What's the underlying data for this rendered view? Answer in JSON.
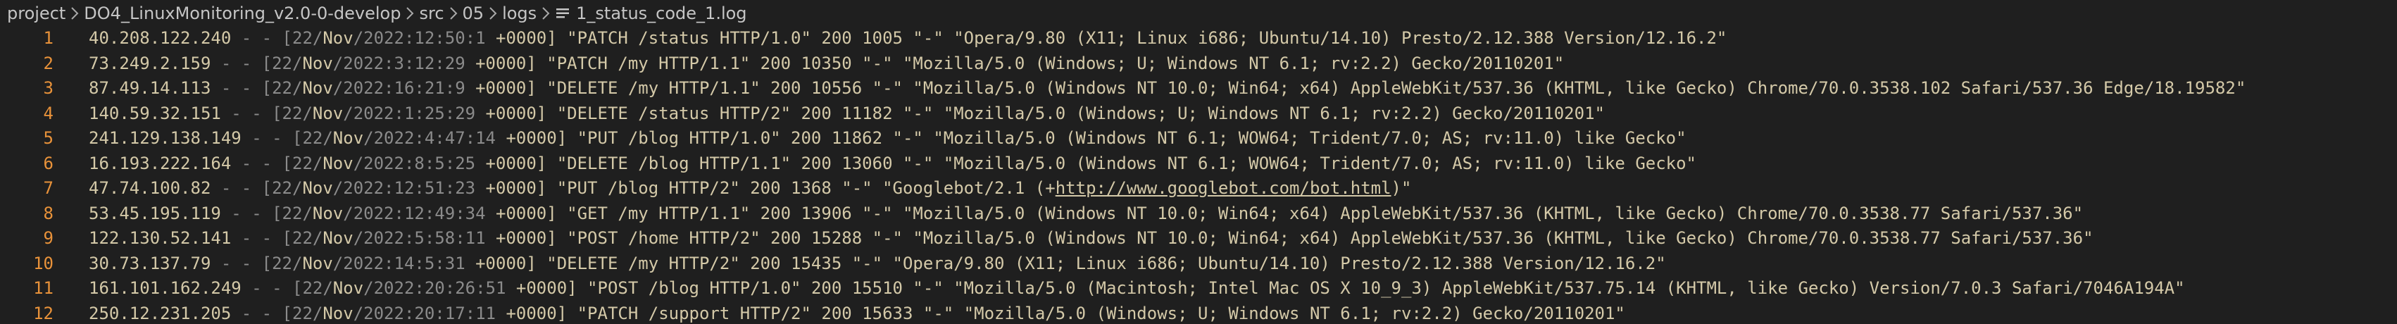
{
  "breadcrumb": {
    "items": [
      "project",
      "DO4_LinuxMonitoring_v2.0-0-develop",
      "src",
      "05",
      "logs"
    ],
    "file": "1_status_code_1.log"
  },
  "editor": {
    "lines": [
      {
        "n": "1",
        "ip": "40.208.122.240",
        "dash": " - - [22/",
        "mon": "Nov",
        "date": "/2022:12:50:1",
        "tz": " +0000",
        "rest": "] \"PATCH /status HTTP/1.0\" 200 1005 \"-\" \"Opera/9.80 (X11; Linux i686; Ubuntu/14.10) Presto/2.12.388 Version/12.16.2\""
      },
      {
        "n": "2",
        "ip": "73.249.2.159",
        "dash": " - - [22/",
        "mon": "Nov",
        "date": "/2022:3:12:29",
        "tz": " +0000",
        "rest": "] \"PATCH /my HTTP/1.1\" 200 10350 \"-\" \"Mozilla/5.0 (Windows; U; Windows NT 6.1; rv:2.2) Gecko/20110201\""
      },
      {
        "n": "3",
        "ip": "87.49.14.113",
        "dash": " - - [22/",
        "mon": "Nov",
        "date": "/2022:16:21:9",
        "tz": " +0000",
        "rest": "] \"DELETE /my HTTP/1.1\" 200 10556 \"-\" \"Mozilla/5.0 (Windows NT 10.0; Win64; x64) AppleWebKit/537.36 (KHTML, like Gecko) Chrome/70.0.3538.102 Safari/537.36 Edge/18.19582\""
      },
      {
        "n": "4",
        "ip": "140.59.32.151",
        "dash": " - - [22/",
        "mon": "Nov",
        "date": "/2022:1:25:29",
        "tz": " +0000",
        "rest": "] \"DELETE /status HTTP/2\" 200 11182 \"-\" \"Mozilla/5.0 (Windows; U; Windows NT 6.1; rv:2.2) Gecko/20110201\""
      },
      {
        "n": "5",
        "ip": "241.129.138.149",
        "dash": " - - [22/",
        "mon": "Nov",
        "date": "/2022:4:47:14",
        "tz": " +0000",
        "rest": "] \"PUT /blog HTTP/1.0\" 200 11862 \"-\" \"Mozilla/5.0 (Windows NT 6.1; WOW64; Trident/7.0; AS; rv:11.0) like Gecko\""
      },
      {
        "n": "6",
        "ip": "16.193.222.164",
        "dash": " - - [22/",
        "mon": "Nov",
        "date": "/2022:8:5:25",
        "tz": " +0000",
        "rest": "] \"DELETE /blog HTTP/1.1\" 200 13060 \"-\" \"Mozilla/5.0 (Windows NT 6.1; WOW64; Trident/7.0; AS; rv:11.0) like Gecko\""
      },
      {
        "n": "7",
        "ip": "47.74.100.82",
        "dash": " - - [22/",
        "mon": "Nov",
        "date": "/2022:12:51:23",
        "tz": " +0000",
        "rest": "] \"PUT /blog HTTP/2\" 200 1368 \"-\" \"Googlebot/2.1 (+",
        "link": "http://www.googlebot.com/bot.html",
        "tail": ")\""
      },
      {
        "n": "8",
        "ip": "53.45.195.119",
        "dash": " - - [22/",
        "mon": "Nov",
        "date": "/2022:12:49:34",
        "tz": " +0000",
        "rest": "] \"GET /my HTTP/1.1\" 200 13906 \"-\" \"Mozilla/5.0 (Windows NT 10.0; Win64; x64) AppleWebKit/537.36 (KHTML, like Gecko) Chrome/70.0.3538.77 Safari/537.36\""
      },
      {
        "n": "9",
        "ip": "122.130.52.141",
        "dash": " - - [22/",
        "mon": "Nov",
        "date": "/2022:5:58:11",
        "tz": " +0000",
        "rest": "] \"POST /home HTTP/2\" 200 15288 \"-\" \"Mozilla/5.0 (Windows NT 10.0; Win64; x64) AppleWebKit/537.36 (KHTML, like Gecko) Chrome/70.0.3538.77 Safari/537.36\""
      },
      {
        "n": "10",
        "ip": "30.73.137.79",
        "dash": " - - [22/",
        "mon": "Nov",
        "date": "/2022:14:5:31",
        "tz": " +0000",
        "rest": "] \"DELETE /my HTTP/2\" 200 15435 \"-\" \"Opera/9.80 (X11; Linux i686; Ubuntu/14.10) Presto/2.12.388 Version/12.16.2\""
      },
      {
        "n": "11",
        "ip": "161.101.162.249",
        "dash": " - - [22/",
        "mon": "Nov",
        "date": "/2022:20:26:51",
        "tz": " +0000",
        "rest": "] \"POST /blog HTTP/1.0\" 200 15510 \"-\" \"Mozilla/5.0 (Macintosh; Intel Mac OS X 10_9_3) AppleWebKit/537.75.14 (KHTML, like Gecko) Version/7.0.3 Safari/7046A194A\""
      },
      {
        "n": "12",
        "ip": "250.12.231.205",
        "dash": " - - [22/",
        "mon": "Nov",
        "date": "/2022:20:17:11",
        "tz": " +0000",
        "rest": "] \"PATCH /support HTTP/2\" 200 15633 \"-\" \"Mozilla/5.0 (Windows; U; Windows NT 6.1; rv:2.2) Gecko/20110201\""
      }
    ]
  }
}
